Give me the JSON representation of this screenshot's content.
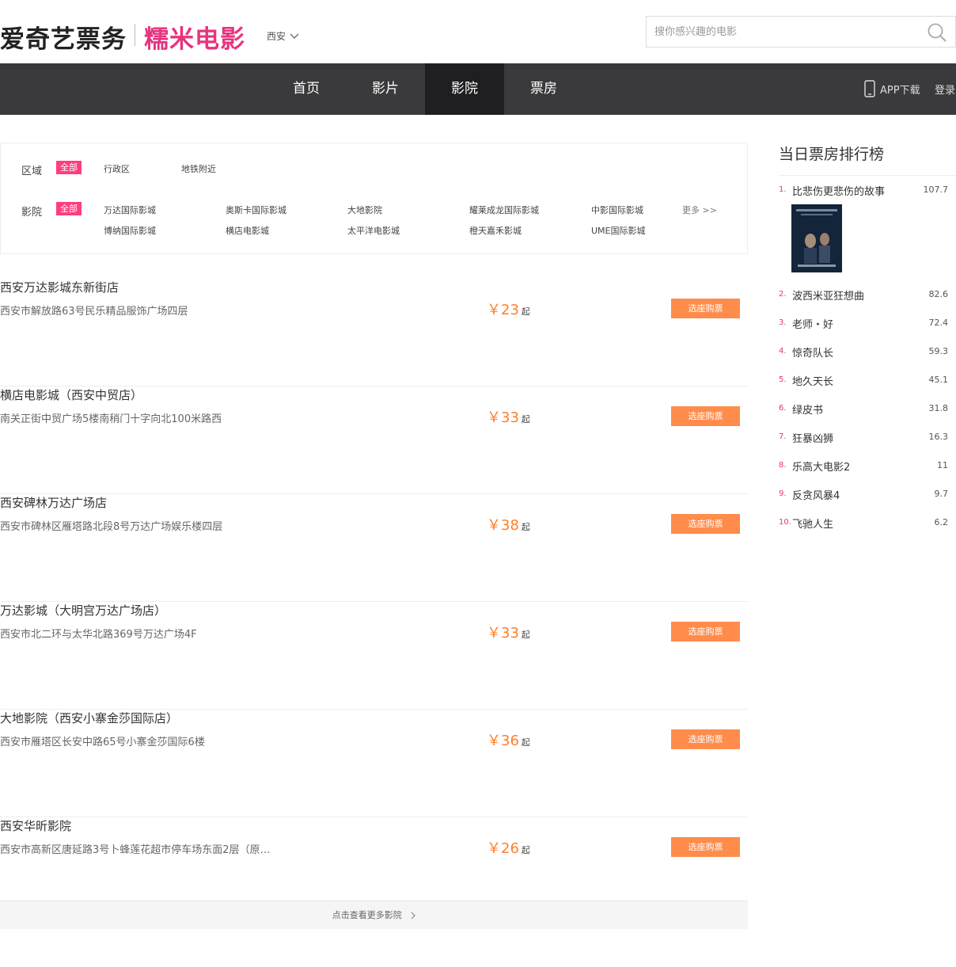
{
  "header": {
    "logo_main": "爱奇艺票务",
    "logo_sub": "糯米电影",
    "city": "西安",
    "search_placeholder": "搜你感兴趣的电影"
  },
  "nav": {
    "items": [
      "首页",
      "影片",
      "影院",
      "票房"
    ],
    "active": "影院",
    "app_download": "APP下载",
    "login": "登录"
  },
  "filter": {
    "area_label": "区域",
    "area_all": "全部",
    "area_options": [
      "行政区",
      "地铁附近"
    ],
    "cinema_label": "影院",
    "cinema_all": "全部",
    "cinema_options": [
      [
        "万达国际影城",
        "奥斯卡国际影城",
        "大地影院",
        "耀莱成龙国际影城",
        "中影国际影城"
      ],
      [
        "博纳国际影城",
        "横店电影城",
        "太平洋电影城",
        "橙天嘉禾影城",
        "UME国际影城"
      ]
    ],
    "more": "更多 >>"
  },
  "cinemas": [
    {
      "name": "西安万达影城东新街店",
      "address": "西安市解放路63号民乐精品服饰广场四层",
      "price": "￥23",
      "suffix": "起",
      "button": "选座购票"
    },
    {
      "name": "横店电影城（西安中贸店）",
      "address": "南关正街中贸广场5楼南稍门十字向北100米路西",
      "price": "￥33",
      "suffix": "起",
      "button": "选座购票"
    },
    {
      "name": "西安碑林万达广场店",
      "address": "西安市碑林区雁塔路北段8号万达广场娱乐楼四层",
      "price": "￥38",
      "suffix": "起",
      "button": "选座购票"
    },
    {
      "name": "万达影城（大明宫万达广场店）",
      "address": "西安市北二环与太华北路369号万达广场4F",
      "price": "￥33",
      "suffix": "起",
      "button": "选座购票"
    },
    {
      "name": "大地影院（西安小寨金莎国际店）",
      "address": "西安市雁塔区长安中路65号小寨金莎国际6楼",
      "price": "￥36",
      "suffix": "起",
      "button": "选座购票"
    },
    {
      "name": "西安华昕影院",
      "address": "西安市高新区唐延路3号卜蜂莲花超市停车场东面2层（原…",
      "price": "￥26",
      "suffix": "起",
      "button": "选座购票"
    }
  ],
  "more_cinemas": "点击查看更多影院",
  "box_office": {
    "title": "当日票房排行榜",
    "items": [
      {
        "rank": "1.",
        "name": "比悲伤更悲伤的故事",
        "value": "107.7"
      },
      {
        "rank": "2.",
        "name": "波西米亚狂想曲",
        "value": "82.6"
      },
      {
        "rank": "3.",
        "name": "老师・好",
        "value": "72.4"
      },
      {
        "rank": "4.",
        "name": "惊奇队长",
        "value": "59.3"
      },
      {
        "rank": "5.",
        "name": "地久天长",
        "value": "45.1"
      },
      {
        "rank": "6.",
        "name": "绿皮书",
        "value": "31.8"
      },
      {
        "rank": "7.",
        "name": "狂暴凶狮",
        "value": "16.3"
      },
      {
        "rank": "8.",
        "name": "乐高大电影2",
        "value": "11"
      },
      {
        "rank": "9.",
        "name": "反贪风暴4",
        "value": "9.7"
      },
      {
        "rank": "10.",
        "name": "飞驰人生",
        "value": "6.2"
      }
    ]
  },
  "colors": {
    "brand_pink": "#e8337f",
    "price_orange": "#ff7f2a",
    "button_orange": "#ff8c4b",
    "nav_bg": "#3a3a3c",
    "nav_active_bg": "#1f1f21"
  }
}
